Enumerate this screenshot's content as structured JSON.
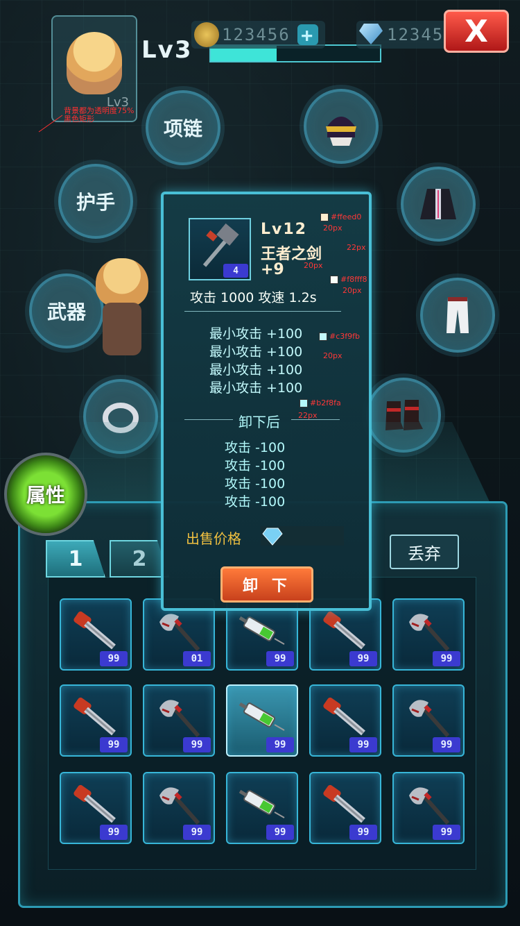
{
  "header": {
    "level_label": "Lv3",
    "xp_fraction": 0.39,
    "coins": "123456",
    "coins_plus": "+",
    "gems": "123456",
    "close_label": "X"
  },
  "avatar": {
    "level": "Lv3"
  },
  "annotation": {
    "note": "背景都为透明度75%黑色矩形",
    "items": [
      {
        "label": "#ffeed0",
        "color": "#ffeed0"
      },
      {
        "label": "20px"
      },
      {
        "label": "22px"
      },
      {
        "label": "20px"
      },
      {
        "label": "#f8fff8",
        "color": "#f8fff8"
      },
      {
        "label": "20px"
      },
      {
        "label": "#c3f9fb",
        "color": "#c3f9fb"
      },
      {
        "label": "20px"
      },
      {
        "label": "#b2f8fa",
        "color": "#b2f8fa"
      },
      {
        "label": "22px"
      }
    ]
  },
  "slots": {
    "necklace": "项链",
    "gloves": "护手",
    "weapon": "武器",
    "helmet_icon": "helmet-icon",
    "coat_icon": "coat-icon",
    "pants_icon": "pants-icon",
    "ring_icon": "ring-icon",
    "boots_icon": "boots-icon"
  },
  "attr_button": "属性",
  "tabs": [
    {
      "label": "1",
      "active": true
    },
    {
      "label": "2",
      "active": false
    }
  ],
  "discard_label": "丢弃",
  "tooltip": {
    "level": "Lv12",
    "name": "王者之剑",
    "enhance": "+9",
    "icon_badge": "4",
    "main_stats": "攻击 1000  攻速 1.2s",
    "bonus_stats": [
      "最小攻击  +100",
      "最小攻击  +100",
      "最小攻击  +100",
      "最小攻击  +100"
    ],
    "after_unequip_title": "卸下后",
    "after_stats": [
      "攻击  -100",
      "攻击  -100",
      "攻击  -100",
      "攻击  -100"
    ],
    "sell_price_label": "出售价格",
    "unequip_label": "卸 下",
    "colors": {
      "title": "#ffeed0",
      "main": "#f8fff8",
      "bonus": "#c3f9fb",
      "sub": "#b2f8fa"
    }
  },
  "inventory": {
    "rows": [
      [
        {
          "item": "wrench-icon",
          "count": "99"
        },
        {
          "item": "axe-icon",
          "count": "01"
        },
        {
          "item": "syringe-icon",
          "count": "99"
        },
        {
          "item": "wrench-icon",
          "count": "99"
        },
        {
          "item": "axe-icon",
          "count": "99"
        }
      ],
      [
        {
          "item": "wrench-icon",
          "count": "99"
        },
        {
          "item": "axe-icon",
          "count": "99"
        },
        {
          "item": "syringe-icon",
          "count": "99",
          "selected": true
        },
        {
          "item": "wrench-icon",
          "count": "99"
        },
        {
          "item": "axe-icon",
          "count": "99"
        }
      ],
      [
        {
          "item": "wrench-icon",
          "count": "99"
        },
        {
          "item": "axe-icon",
          "count": "99"
        },
        {
          "item": "syringe-icon",
          "count": "99"
        },
        {
          "item": "wrench-icon",
          "count": "99"
        },
        {
          "item": "axe-icon",
          "count": "99"
        }
      ]
    ]
  }
}
